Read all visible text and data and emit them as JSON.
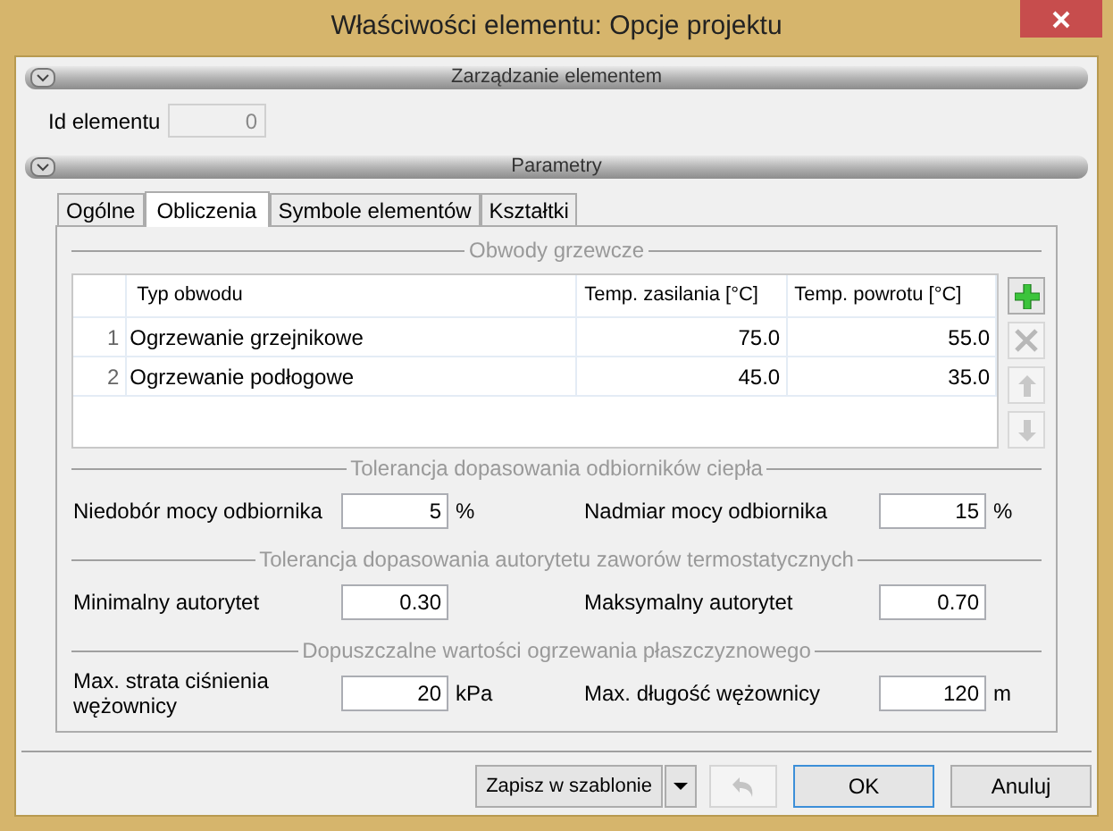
{
  "window": {
    "title": "Właściwości elementu: Opcje projektu"
  },
  "management": {
    "title": "Zarządzanie elementem",
    "id_label": "Id elementu",
    "id_value": "0"
  },
  "parameters": {
    "title": "Parametry"
  },
  "tabs": [
    {
      "label": "Ogólne",
      "selected": false
    },
    {
      "label": "Obliczenia",
      "selected": true
    },
    {
      "label": "Symbole elementów",
      "selected": false
    },
    {
      "label": "Kształtki",
      "selected": false
    }
  ],
  "circuits": {
    "title": "Obwody grzewcze",
    "columns": [
      "Typ obwodu",
      "Temp. zasilania [°C]",
      "Temp. powrotu [°C]"
    ],
    "rows": [
      {
        "index": "1",
        "cells": [
          "Ogrzewanie grzejnikowe",
          "75.0",
          "55.0"
        ]
      },
      {
        "index": "2",
        "cells": [
          "Ogrzewanie podłogowe",
          "45.0",
          "35.0"
        ]
      }
    ],
    "tools": [
      {
        "kind": "add",
        "disabled": false
      },
      {
        "kind": "delete",
        "disabled": true
      },
      {
        "kind": "up",
        "disabled": true
      },
      {
        "kind": "down",
        "disabled": true
      }
    ]
  },
  "groups": [
    {
      "title": "Tolerancja dopasowania odbiorników ciepła",
      "fields": [
        {
          "label": "Niedobór mocy odbiornika",
          "value": "5",
          "unit": "%"
        },
        {
          "label": "Nadmiar mocy odbiornika",
          "value": "15",
          "unit": "%"
        }
      ]
    },
    {
      "title": "Tolerancja dopasowania autorytetu zaworów termostatycznych",
      "fields": [
        {
          "label": "Minimalny autorytet",
          "value": "0.30"
        },
        {
          "label": "Maksymalny autorytet",
          "value": "0.70"
        }
      ]
    },
    {
      "title": "Dopuszczalne wartości ogrzewania płaszczyznowego",
      "fields": [
        {
          "label": "Max. strata ciśnienia wężownicy",
          "value": "20",
          "unit": "kPa"
        },
        {
          "label": "Max. długość wężownicy",
          "value": "120",
          "unit": "m"
        }
      ]
    }
  ],
  "buttons": {
    "save_template": "Zapisz w szablonie",
    "undo_disabled": true,
    "ok": "OK",
    "cancel": "Anuluj"
  }
}
